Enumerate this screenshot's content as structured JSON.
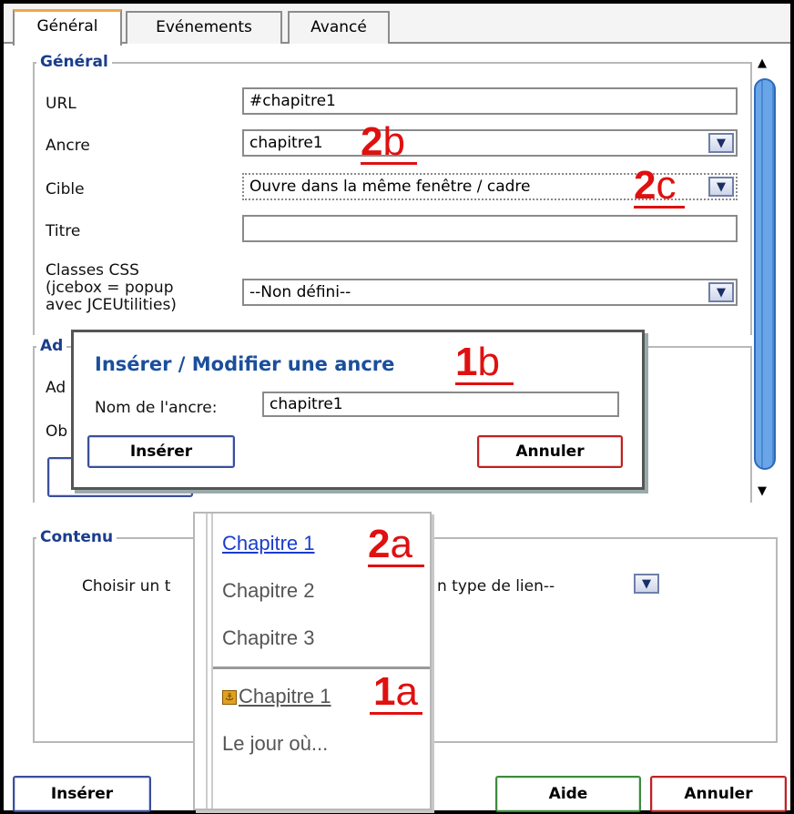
{
  "tabs": [
    "Général",
    "Evénements",
    "Avancé"
  ],
  "general": {
    "legend": "Général",
    "url_label": "URL",
    "url_value": "#chapitre1",
    "anchor_label": "Ancre",
    "anchor_value": "chapitre1",
    "target_label": "Cible",
    "target_value": "Ouvre dans la même fenêtre / cadre",
    "title_label": "Titre",
    "title_value": "",
    "css_label_1": "Classes CSS",
    "css_label_2": "(jcebox = popup",
    "css_label_3": "avec JCEUtilities)",
    "css_value": "--Non défini--"
  },
  "hidden_section": {
    "legend": "Ad",
    "row1": "Ad",
    "row2": "Ob"
  },
  "anchor_dialog": {
    "title": "Insérer / Modifier une ancre",
    "name_label": "Nom de l'ancre:",
    "name_value": "chapitre1",
    "insert_label": "Insérer",
    "cancel_label": "Annuler"
  },
  "content": {
    "legend": "Contenu",
    "choose_label": "Choisir un t",
    "choose_value": "n type de lien--"
  },
  "link_menu": {
    "items": [
      "Chapitre 1",
      "Chapitre 2",
      "Chapitre 3"
    ],
    "anchor_item": "Chapitre 1",
    "extra_item": "Le jour où..."
  },
  "annotations": {
    "a1b_num": "1",
    "a1b_letter": "b",
    "a2b_num": "2",
    "a2b_letter": "b",
    "a2c_num": "2",
    "a2c_letter": "c",
    "a2a_num": "2",
    "a2a_letter": "a",
    "a1a_num": "1",
    "a1a_letter": "a"
  },
  "footer": {
    "insert_label": "Insérer",
    "help_label": "Aide",
    "cancel_label": "Annuler"
  },
  "icons": {
    "dropdown": "chevron-down-icon",
    "anchor": "anchor-icon",
    "scroll_up": "arrow-up-icon",
    "scroll_down": "arrow-down-icon"
  },
  "colors": {
    "annotation_red": "#e01010",
    "legend_blue": "#1a3d8c",
    "link_blue": "#1a3dcc",
    "tab_accent": "#f0a848"
  }
}
